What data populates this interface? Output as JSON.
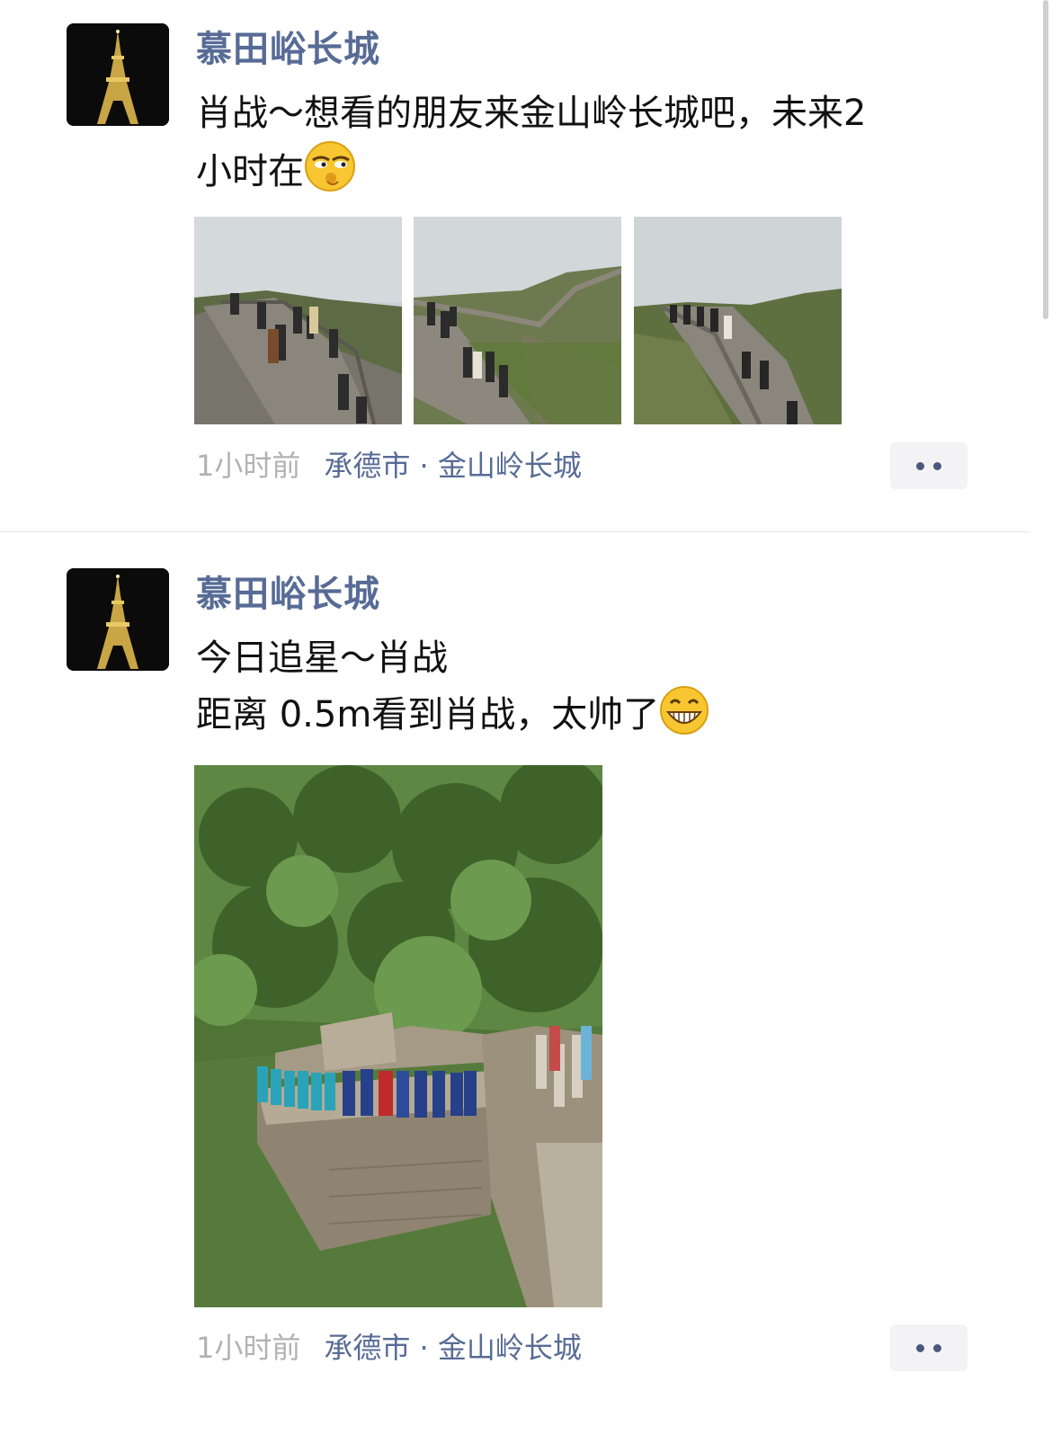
{
  "posts": [
    {
      "username": "慕田峪长城",
      "text_line1": "肖战～想看的朋友来金山岭长城吧，未来2",
      "text_line2": "小时在",
      "emoji": "smirk-emoji",
      "time": "1小时前",
      "location": "承德市 · 金山岭长城",
      "images": [
        "great-wall-stairs-photo",
        "great-wall-ridge-photo",
        "great-wall-crowd-photo"
      ]
    },
    {
      "username": "慕田峪长城",
      "text_line1": "今日追星～肖战",
      "text_line2": "距离 0.5m看到肖战，太帅了",
      "emoji": "grin-emoji",
      "time": "1小时前",
      "location": "承德市 · 金山岭长城",
      "images": [
        "great-wall-film-crew-photo"
      ]
    }
  ],
  "colors": {
    "name": "#576b95",
    "meta": "#b2b2b2",
    "divider": "#e8e8e8"
  }
}
